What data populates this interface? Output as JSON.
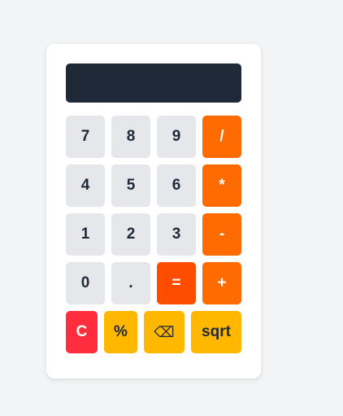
{
  "display": {
    "value": ""
  },
  "keys": {
    "k7": "7",
    "k8": "8",
    "k9": "9",
    "div": "/",
    "k4": "4",
    "k5": "5",
    "k6": "6",
    "mul": "*",
    "k1": "1",
    "k2": "2",
    "k3": "3",
    "sub": "-",
    "k0": "0",
    "dot": ".",
    "eq": "=",
    "add": "+",
    "clear": "C",
    "percent": "%",
    "backspace": "⌫",
    "sqrt": "sqrt"
  },
  "icons": {
    "backspace": "backspace-icon"
  },
  "colors": {
    "background": "#f3f4f6",
    "card": "#ffffff",
    "display": "#1f2937",
    "number_key": "#e5e7eb",
    "operator_key": "#ff6b00",
    "equals_key": "#ff4d00",
    "clear_key": "#ff2d3d",
    "function_key": "#ffb700"
  }
}
